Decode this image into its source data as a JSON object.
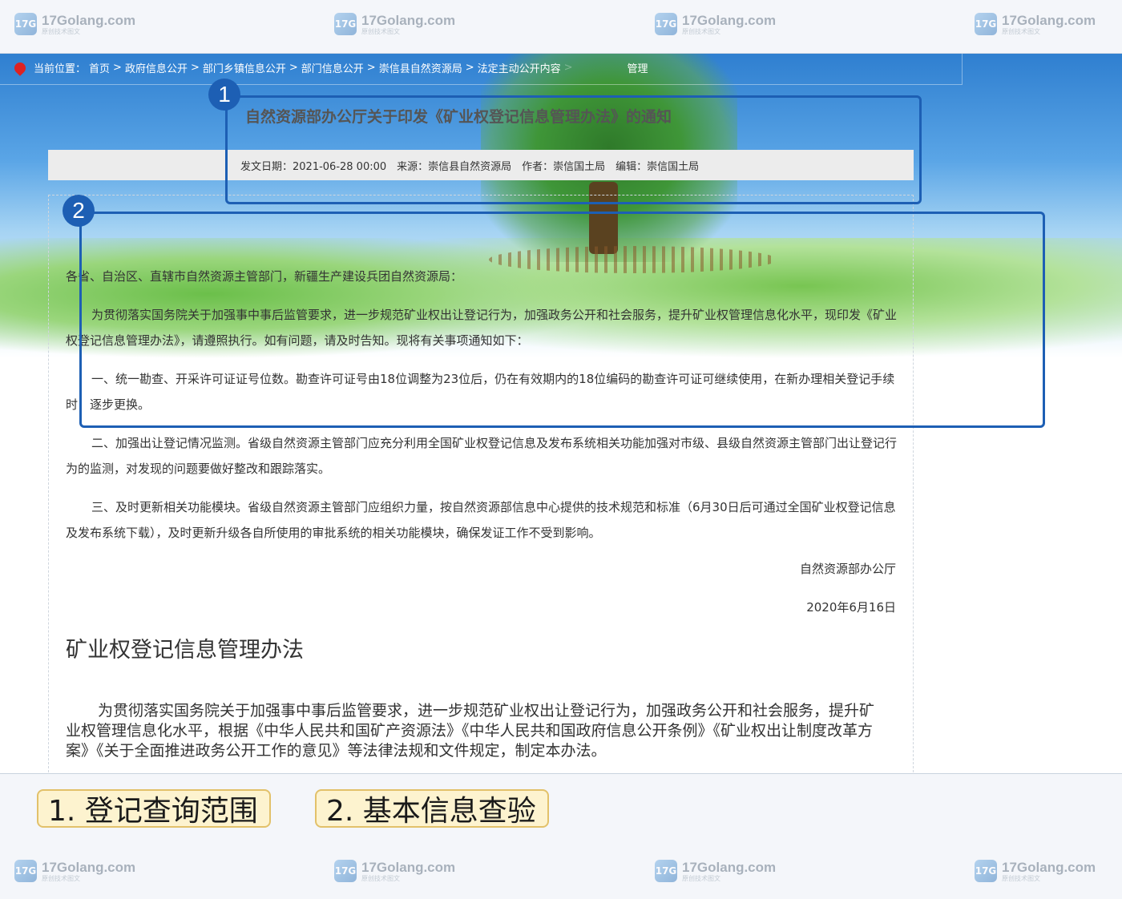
{
  "watermark": {
    "name": "17Golang.com",
    "sub": "原创技术图文",
    "logo": "17G"
  },
  "breadcrumb": {
    "label": "当前位置：",
    "items": [
      "首页",
      ">",
      "政府信息公开",
      ">",
      "部门乡镇信息公开",
      ">",
      "部门信息公开",
      ">",
      "崇信县自然资源局",
      ">",
      "法定主动公开内容",
      ">",
      "",
      "管理"
    ]
  },
  "article": {
    "title": "自然资源部办公厅关于印发《矿业权登记信息管理办法》的通知",
    "meta": "发文日期：2021-06-28 00:00　来源：崇信县自然资源局　作者：崇信国土局　编辑：崇信国土局",
    "greeting": "各省、自治区、直辖市自然资源主管部门，新疆生产建设兵团自然资源局：",
    "p1": "为贯彻落实国务院关于加强事中事后监管要求，进一步规范矿业权出让登记行为，加强政务公开和社会服务，提升矿业权管理信息化水平，现印发《矿业权登记信息管理办法》，请遵照执行。如有问题，请及时告知。现将有关事项通知如下：",
    "p2": "一、统一勘查、开采许可证证号位数。勘查许可证号由18位调整为23位后，仍在有效期内的18位编码的勘查许可证可继续使用，在新办理相关登记手续时，逐步更换。",
    "p3": "二、加强出让登记情况监测。省级自然资源主管部门应充分利用全国矿业权登记信息及发布系统相关功能加强对市级、县级自然资源主管部门出让登记行为的监测，对发现的问题要做好整改和跟踪落实。",
    "p4": "三、及时更新相关功能模块。省级自然资源主管部门应组织力量，按自然资源部信息中心提供的技术规范和标准（6月30日后可通过全国矿业权登记信息及发布系统下载），及时更新升级各自所使用的审批系统的相关功能模块，确保发证工作不受到影响。",
    "sign_org": "自然资源部办公厅",
    "sign_date": "2020年6月16日",
    "subheading": "矿业权登记信息管理办法",
    "p5": "为贯彻落实国务院关于加强事中事后监管要求，进一步规范矿业权出让登记行为，加强政务公开和社会服务，提升矿业权管理信息化水平，根据《中华人民共和国矿产资源法》《中华人民共和国政府信息公开条例》《矿业权出让制度改革方案》《关于全面推进政务公开工作的意见》等法律法规和文件规定，制定本办法。"
  },
  "annotations": {
    "badge1": "1",
    "badge2": "2",
    "label1": "1. 登记查询范围",
    "label2": "2. 基本信息查验",
    "color": "#1d5fb4"
  }
}
